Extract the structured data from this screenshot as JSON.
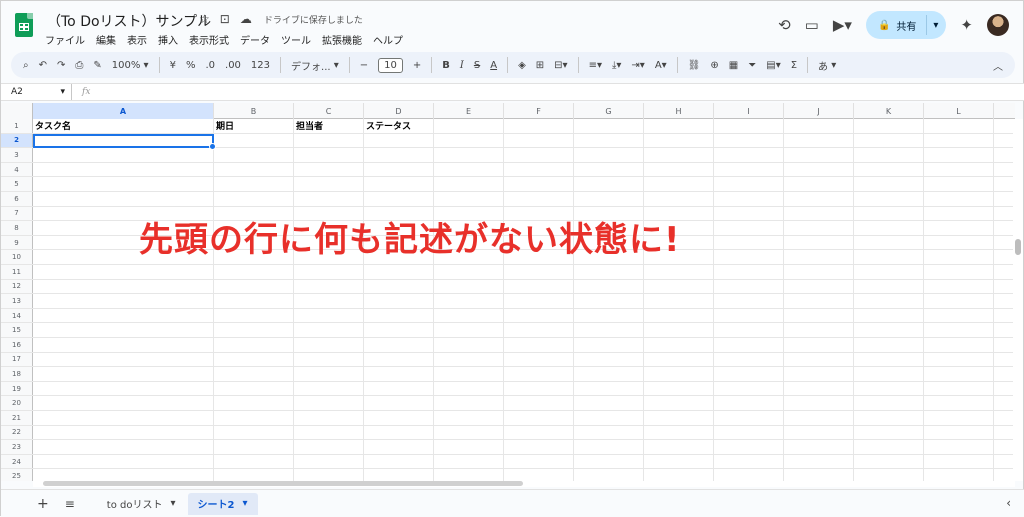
{
  "header": {
    "title": "（To Doリスト）サンプル",
    "save_status": "ドライブに保存しました",
    "share_label": "共有",
    "menu": [
      "ファイル",
      "編集",
      "表示",
      "挿入",
      "表示形式",
      "データ",
      "ツール",
      "拡張機能",
      "ヘルプ"
    ]
  },
  "toolbar": {
    "zoom": "100%",
    "currency": "¥",
    "percent": "%",
    "dec_decrease": ".0",
    "dec_increase": ".00",
    "number_format": "123",
    "font": "デフォ...",
    "font_size": "10",
    "input_tool": "あ"
  },
  "formula_bar": {
    "name_box": "A2",
    "fx": "fx",
    "value": ""
  },
  "grid": {
    "columns": [
      "A",
      "B",
      "C",
      "D",
      "E",
      "F",
      "G",
      "H",
      "I",
      "J",
      "K",
      "L"
    ],
    "row_numbers": [
      "1",
      "2",
      "3",
      "4",
      "5",
      "6",
      "7",
      "8",
      "9",
      "10",
      "11",
      "12",
      "13",
      "14",
      "15",
      "16",
      "17",
      "18",
      "19",
      "20",
      "21",
      "22",
      "23",
      "24",
      "25"
    ],
    "row1": [
      "タスク名",
      "期日",
      "担当者",
      "ステータス"
    ]
  },
  "overlay_text": "先頭の行に何も記述がない状態に!",
  "sheets": [
    {
      "label": "to doリスト"
    },
    {
      "label": "シート2"
    }
  ],
  "colors": {
    "accent": "#1a73e8",
    "overlay": "#e8302a",
    "share_bg": "#c2e7ff"
  }
}
